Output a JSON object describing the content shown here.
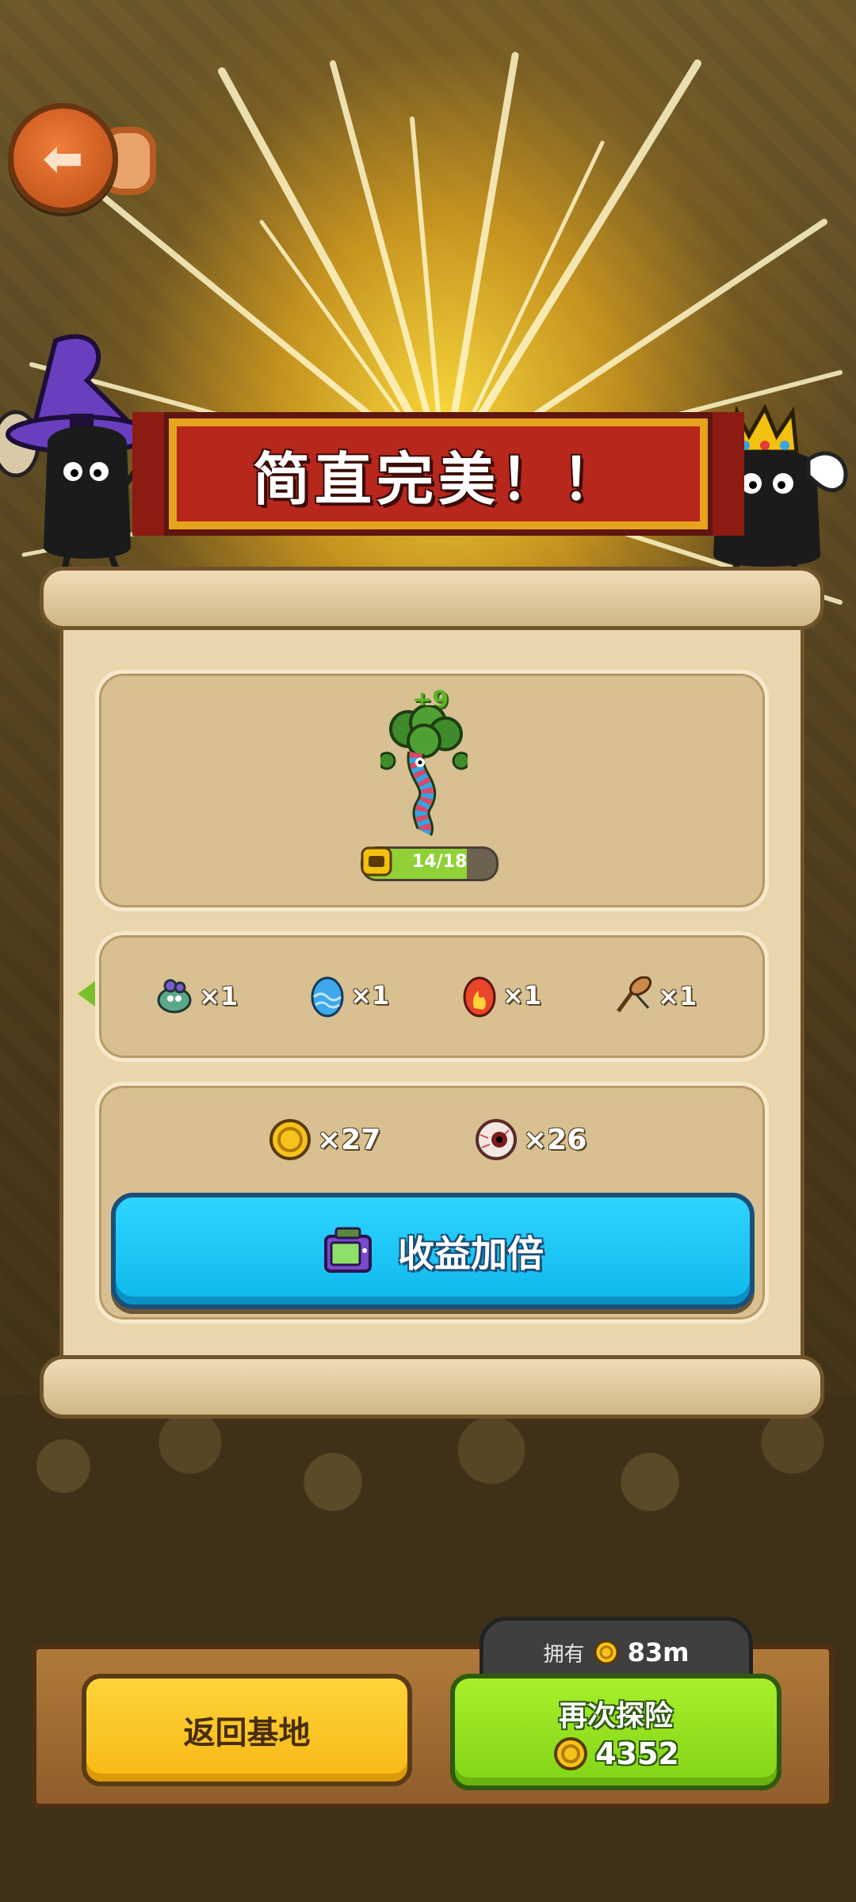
{
  "banner": {
    "title": "简直完美！！"
  },
  "level": {
    "plus": "+9",
    "progress": "14/18",
    "fill_fraction": 0.78
  },
  "rewards": [
    {
      "icon": "monster-icon",
      "qty": "×1"
    },
    {
      "icon": "blue-egg-icon",
      "qty": "×1"
    },
    {
      "icon": "red-egg-icon",
      "qty": "×1"
    },
    {
      "icon": "club-weapon-icon",
      "qty": "×1"
    }
  ],
  "currencies": [
    {
      "icon": "gold-coin-icon",
      "qty": "×27"
    },
    {
      "icon": "eyeball-icon",
      "qty": "×26"
    }
  ],
  "double_button": {
    "label": "收益加倍",
    "icon": "tv-ad-icon"
  },
  "bottom": {
    "own_label": "拥有",
    "own_value": "83m",
    "home_label": "返回基地",
    "again_label": "再次探险",
    "again_cost": "4352"
  },
  "colors": {
    "banner": "#b7271c",
    "double_button": "#19c3f2",
    "home_button": "#f6b915",
    "again_button": "#82d418"
  }
}
